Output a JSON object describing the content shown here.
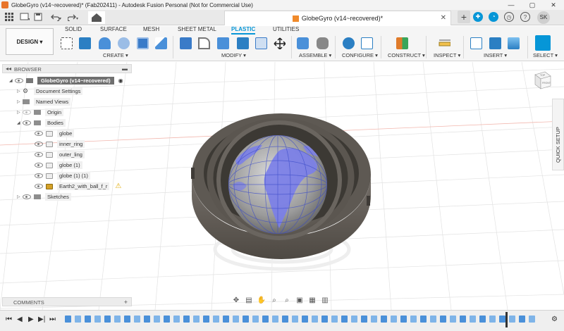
{
  "window": {
    "title": "GlobeGyro (v14~recovered)* (Fab202411) - Autodesk Fusion Personal (Not for Commercial Use)",
    "minimize": "—",
    "maximize": "▢",
    "close": "✕"
  },
  "tabbar": {
    "doc_tab_title": "GlobeGyro (v14~recovered)*",
    "doc_tab_close": "✕",
    "user_initials": "SK",
    "plus": "+"
  },
  "workspace": {
    "mode_button": "DESIGN ▾",
    "tabs": [
      "SOLID",
      "SURFACE",
      "MESH",
      "SHEET METAL",
      "PLASTIC",
      "UTILITIES"
    ],
    "active_tab": "PLASTIC",
    "groups": [
      "CREATE ▾",
      "MODIFY ▾",
      "ASSEMBLE ▾",
      "CONFIGURE ▾",
      "CONSTRUCT ▾",
      "INSPECT ▾",
      "INSERT ▾",
      "SELECT ▾"
    ]
  },
  "browser": {
    "header": "BROWSER",
    "root": "GlobeGyro (v14~recovered)",
    "items": [
      {
        "label": "Document Settings"
      },
      {
        "label": "Named Views"
      },
      {
        "label": "Origin"
      },
      {
        "label": "Bodies"
      },
      {
        "label": "globe"
      },
      {
        "label": "inner_ring"
      },
      {
        "label": "outer_ling"
      },
      {
        "label": "globe (1)"
      },
      {
        "label": "globe (1) (1)"
      },
      {
        "label": "Earth2_with_ball_f_r"
      },
      {
        "label": "Sketches"
      }
    ]
  },
  "comments": {
    "label": "COMMENTS",
    "add": "+"
  },
  "quick_setup": "QUICK SETUP",
  "viewcube": {
    "top": "TOP",
    "front": "FRONT"
  },
  "colors": {
    "accent": "#0696d7",
    "globe_land": "#7b7fe8",
    "ring": "#5a554f"
  }
}
